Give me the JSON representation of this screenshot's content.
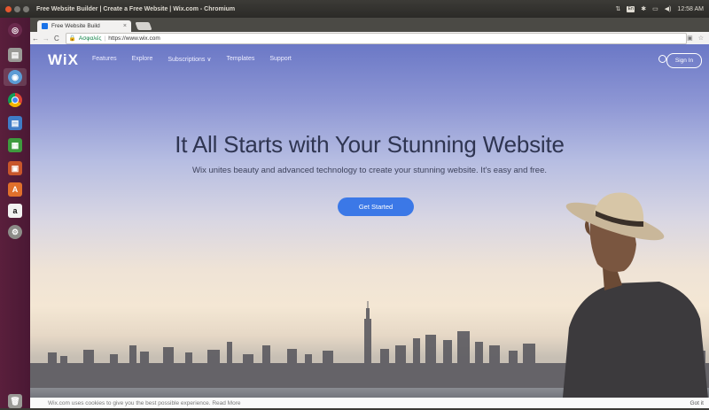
{
  "system": {
    "window_title": "Free Website Builder | Create a Free Website | Wix.com - Chromium",
    "time": "12:58 AM",
    "keyboard_layout": "En"
  },
  "launcher": {
    "items": [
      "dash-home",
      "files",
      "chromium",
      "chrome",
      "writer",
      "calc",
      "impress",
      "software-center",
      "amazon",
      "system-settings",
      "trash"
    ]
  },
  "browser": {
    "tab_title": "Free Website Build",
    "secure_label": "Ασφαλές",
    "url": "https://www.wix.com"
  },
  "site": {
    "logo": "WiX",
    "nav": [
      "Features",
      "Explore",
      "Subscriptions ∨",
      "Templates",
      "Support"
    ],
    "signin": "Sign In",
    "hero_title": "It All Starts with Your Stunning Website",
    "hero_subtitle": "Wix unites beauty and advanced technology to create your stunning website. It's easy and free.",
    "cta": "Get Started",
    "cookie_text": "Wix.com uses cookies to give you the best possible experience. Read More",
    "cookie_ok": "Got it"
  }
}
